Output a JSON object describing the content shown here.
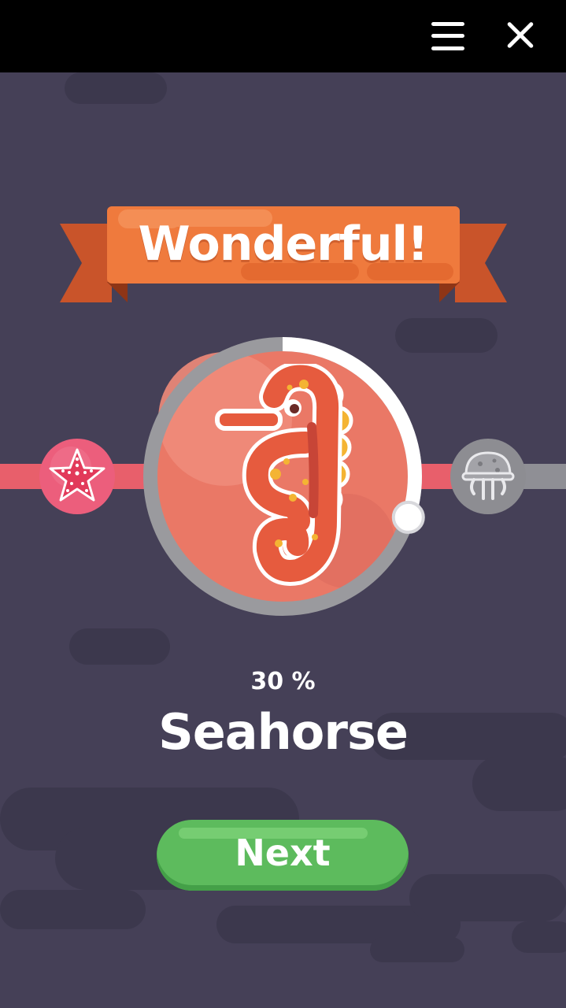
{
  "header": {
    "menu_icon": "hamburger-menu-icon",
    "close_icon": "close-icon"
  },
  "banner": {
    "text": "Wonderful!"
  },
  "progress": {
    "percent_label": "30 %",
    "fraction": 0.3
  },
  "animal": {
    "name": "Seahorse",
    "icon": "seahorse-icon",
    "previous_icon": "starfish-icon",
    "next_icon": "jellyfish-icon"
  },
  "actions": {
    "next_label": "Next"
  },
  "colors": {
    "background": "#454057",
    "banner": "#ef7a3d",
    "ring_track": "#9a9a9e",
    "ring_progress": "#ffffff",
    "circle_fill": "#ea7866",
    "next_button": "#5dbb5d",
    "track_done": "#e85f6b"
  }
}
